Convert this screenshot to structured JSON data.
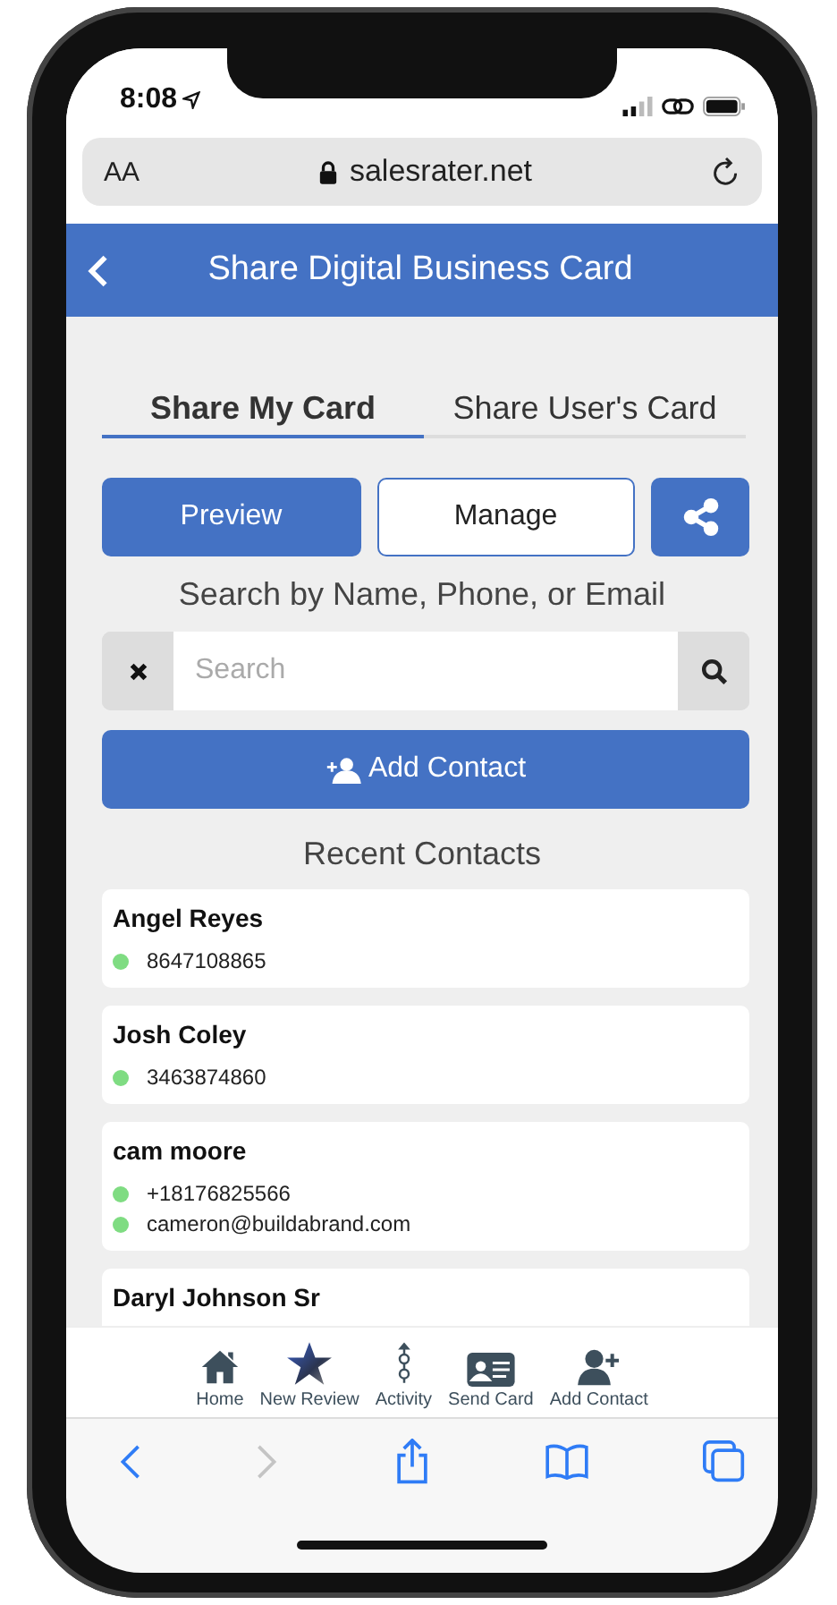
{
  "status_bar": {
    "time": "8:08"
  },
  "browser": {
    "text_size": "AA",
    "url": "salesrater.net"
  },
  "header": {
    "title": "Share Digital Business Card"
  },
  "tabs": [
    {
      "label": "Share My Card",
      "selected": true
    },
    {
      "label": "Share User's Card",
      "selected": false
    }
  ],
  "actions": [
    {
      "kind": "filled",
      "label": "Preview"
    },
    {
      "kind": "outline",
      "label": "Manage"
    },
    {
      "kind": "share"
    }
  ],
  "search": {
    "label": "Search by Name, Phone, or Email",
    "placeholder": "Search"
  },
  "add_contact_button": {
    "label": "Add Contact"
  },
  "recent_contacts": {
    "title": "Recent Contacts",
    "contacts": [
      {
        "name": "Angel Reyes",
        "details": [
          "8647108865"
        ]
      },
      {
        "name": "Josh Coley",
        "details": [
          "3463874860"
        ]
      },
      {
        "name": "cam moore",
        "details": [
          "+18176825566",
          "cameron@buildabrand.com"
        ]
      },
      {
        "name": "Daryl Johnson Sr"
      }
    ]
  },
  "bottom_nav": [
    {
      "kind": "home",
      "label": "Home"
    },
    {
      "kind": "star",
      "label": "New Review"
    },
    {
      "kind": "activity",
      "label": "Activity"
    },
    {
      "kind": "card",
      "label": "Send Card"
    },
    {
      "kind": "add-user",
      "label": "Add Contact"
    }
  ],
  "browser_toolbar": [
    {
      "kind": "back",
      "disabled": false
    },
    {
      "kind": "forward",
      "disabled": true
    },
    {
      "kind": "share",
      "disabled": false
    },
    {
      "kind": "bookmarks",
      "disabled": false
    },
    {
      "kind": "tabs",
      "disabled": false
    }
  ]
}
